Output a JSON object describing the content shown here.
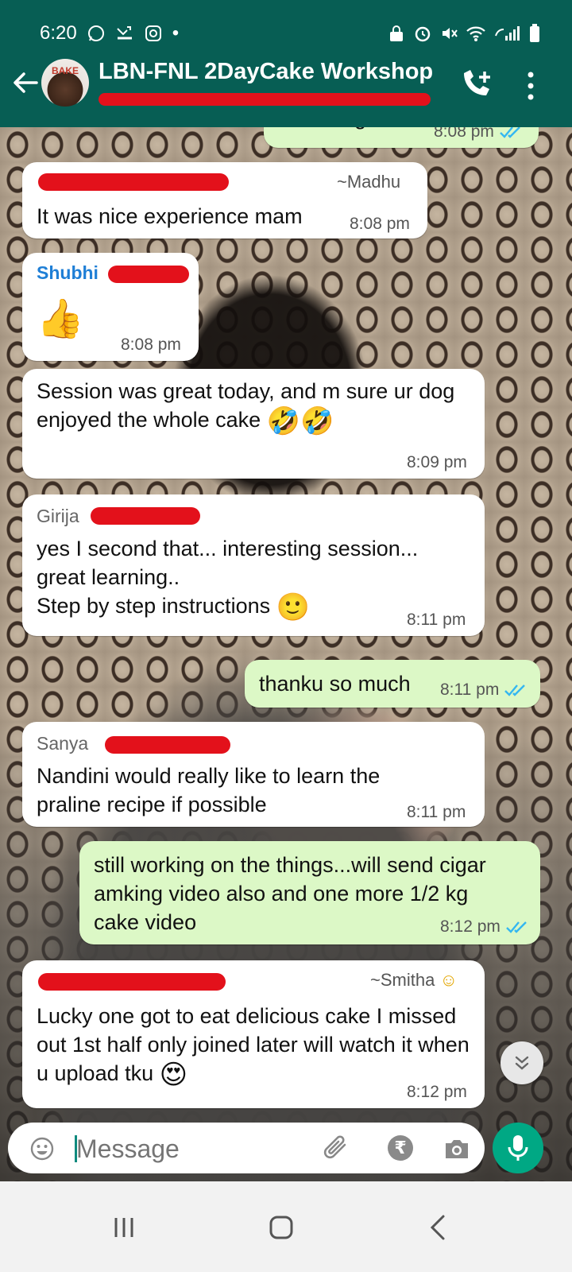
{
  "status_bar": {
    "time": "6:20",
    "dot": "•"
  },
  "header": {
    "title": "LBN-FNL 2DayCake Workshop",
    "avatar_text": "BAKE"
  },
  "messages": [
    {
      "direction": "out",
      "text": "I will msg u all",
      "time": "8:08 pm"
    },
    {
      "direction": "in",
      "alias": "~Madhu",
      "text": "It was nice experience mam",
      "time": "8:08 pm"
    },
    {
      "direction": "in",
      "sender": "Shubhi",
      "emoji": "👍",
      "time": "8:08 pm"
    },
    {
      "direction": "in",
      "text": "Session was great today, and m sure ur dog enjoyed the whole cake",
      "emoji": "🤣🤣",
      "time": "8:09 pm"
    },
    {
      "direction": "in",
      "sender": "Girija",
      "text": "yes I second that... interesting session... great learning..\nStep by step instructions",
      "emoji": "🙂",
      "time": "8:11 pm"
    },
    {
      "direction": "out",
      "text": "thanku so much",
      "time": "8:11 pm"
    },
    {
      "direction": "in",
      "sender": "Sanya",
      "text": "Nandini would really like to learn the praline recipe if possible",
      "time": "8:11 pm"
    },
    {
      "direction": "out",
      "text": "still working on the things...will send cigar amking video also and one more 1/2 kg cake video",
      "time": "8:12 pm"
    },
    {
      "direction": "in",
      "alias": "~Smitha",
      "alias_emoji": "☺",
      "text": "Lucky one got to eat delicious cake I missed out 1st half only joined  later will watch it when u upload  tku",
      "emoji": "😍",
      "time": "8:12 pm"
    }
  ],
  "input": {
    "placeholder": "Message"
  },
  "colors": {
    "header": "#075e54",
    "outgoing_bubble": "#dcf8c6",
    "mic": "#00a884",
    "redaction": "#e3111b",
    "read_ticks": "#34b7f1"
  }
}
